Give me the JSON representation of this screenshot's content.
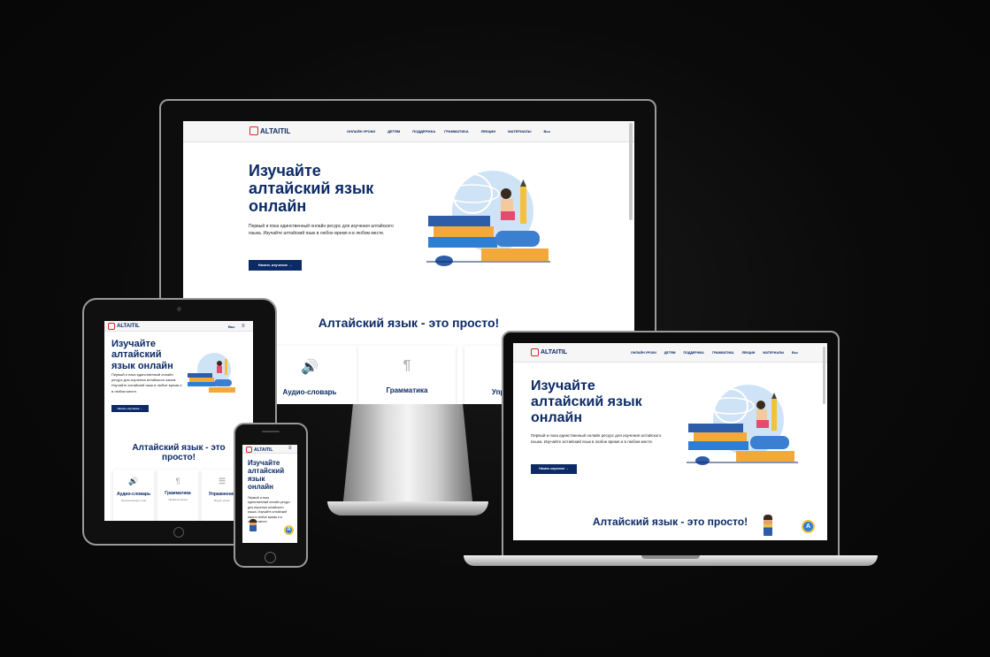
{
  "site": {
    "logo_text": "ALTAITIL",
    "nav": [
      "ОНЛАЙН УРОКИ",
      "ДЕТЯМ",
      "ПОДДЕРЖКА",
      "ГРАММАТИКА",
      "ЛЕКЦИИ",
      "МАТЕРИАЛЫ",
      "Вы•"
    ],
    "hero_title": "Изучайте алтайский язык онлайн",
    "hero_text": "Первый и пока единственный онлайн ресурс для изучения алтайского языка. Изучайте алтайский язык в любое время и в любом месте.",
    "cta_label": "Начать изучение →",
    "section_title": "Алтайский язык - это просто!",
    "badge_letter": "A",
    "cards": [
      {
        "label": "Аудио-словарь",
        "icon": "speaker-icon",
        "glyph": "🔊",
        "text": "Произношение слов"
      },
      {
        "label": "Грамматика",
        "icon": "pilcrow-icon",
        "glyph": "¶",
        "text": "Правила языка"
      },
      {
        "label": "Упражнения",
        "icon": "list-icon",
        "glyph": "☰",
        "text": "Видео уроки"
      }
    ]
  },
  "colors": {
    "brand": "#0c2a66",
    "logo_red": "#d42a2a",
    "accent_blue": "#2d7fd4",
    "accent_orange": "#f2a93a"
  }
}
